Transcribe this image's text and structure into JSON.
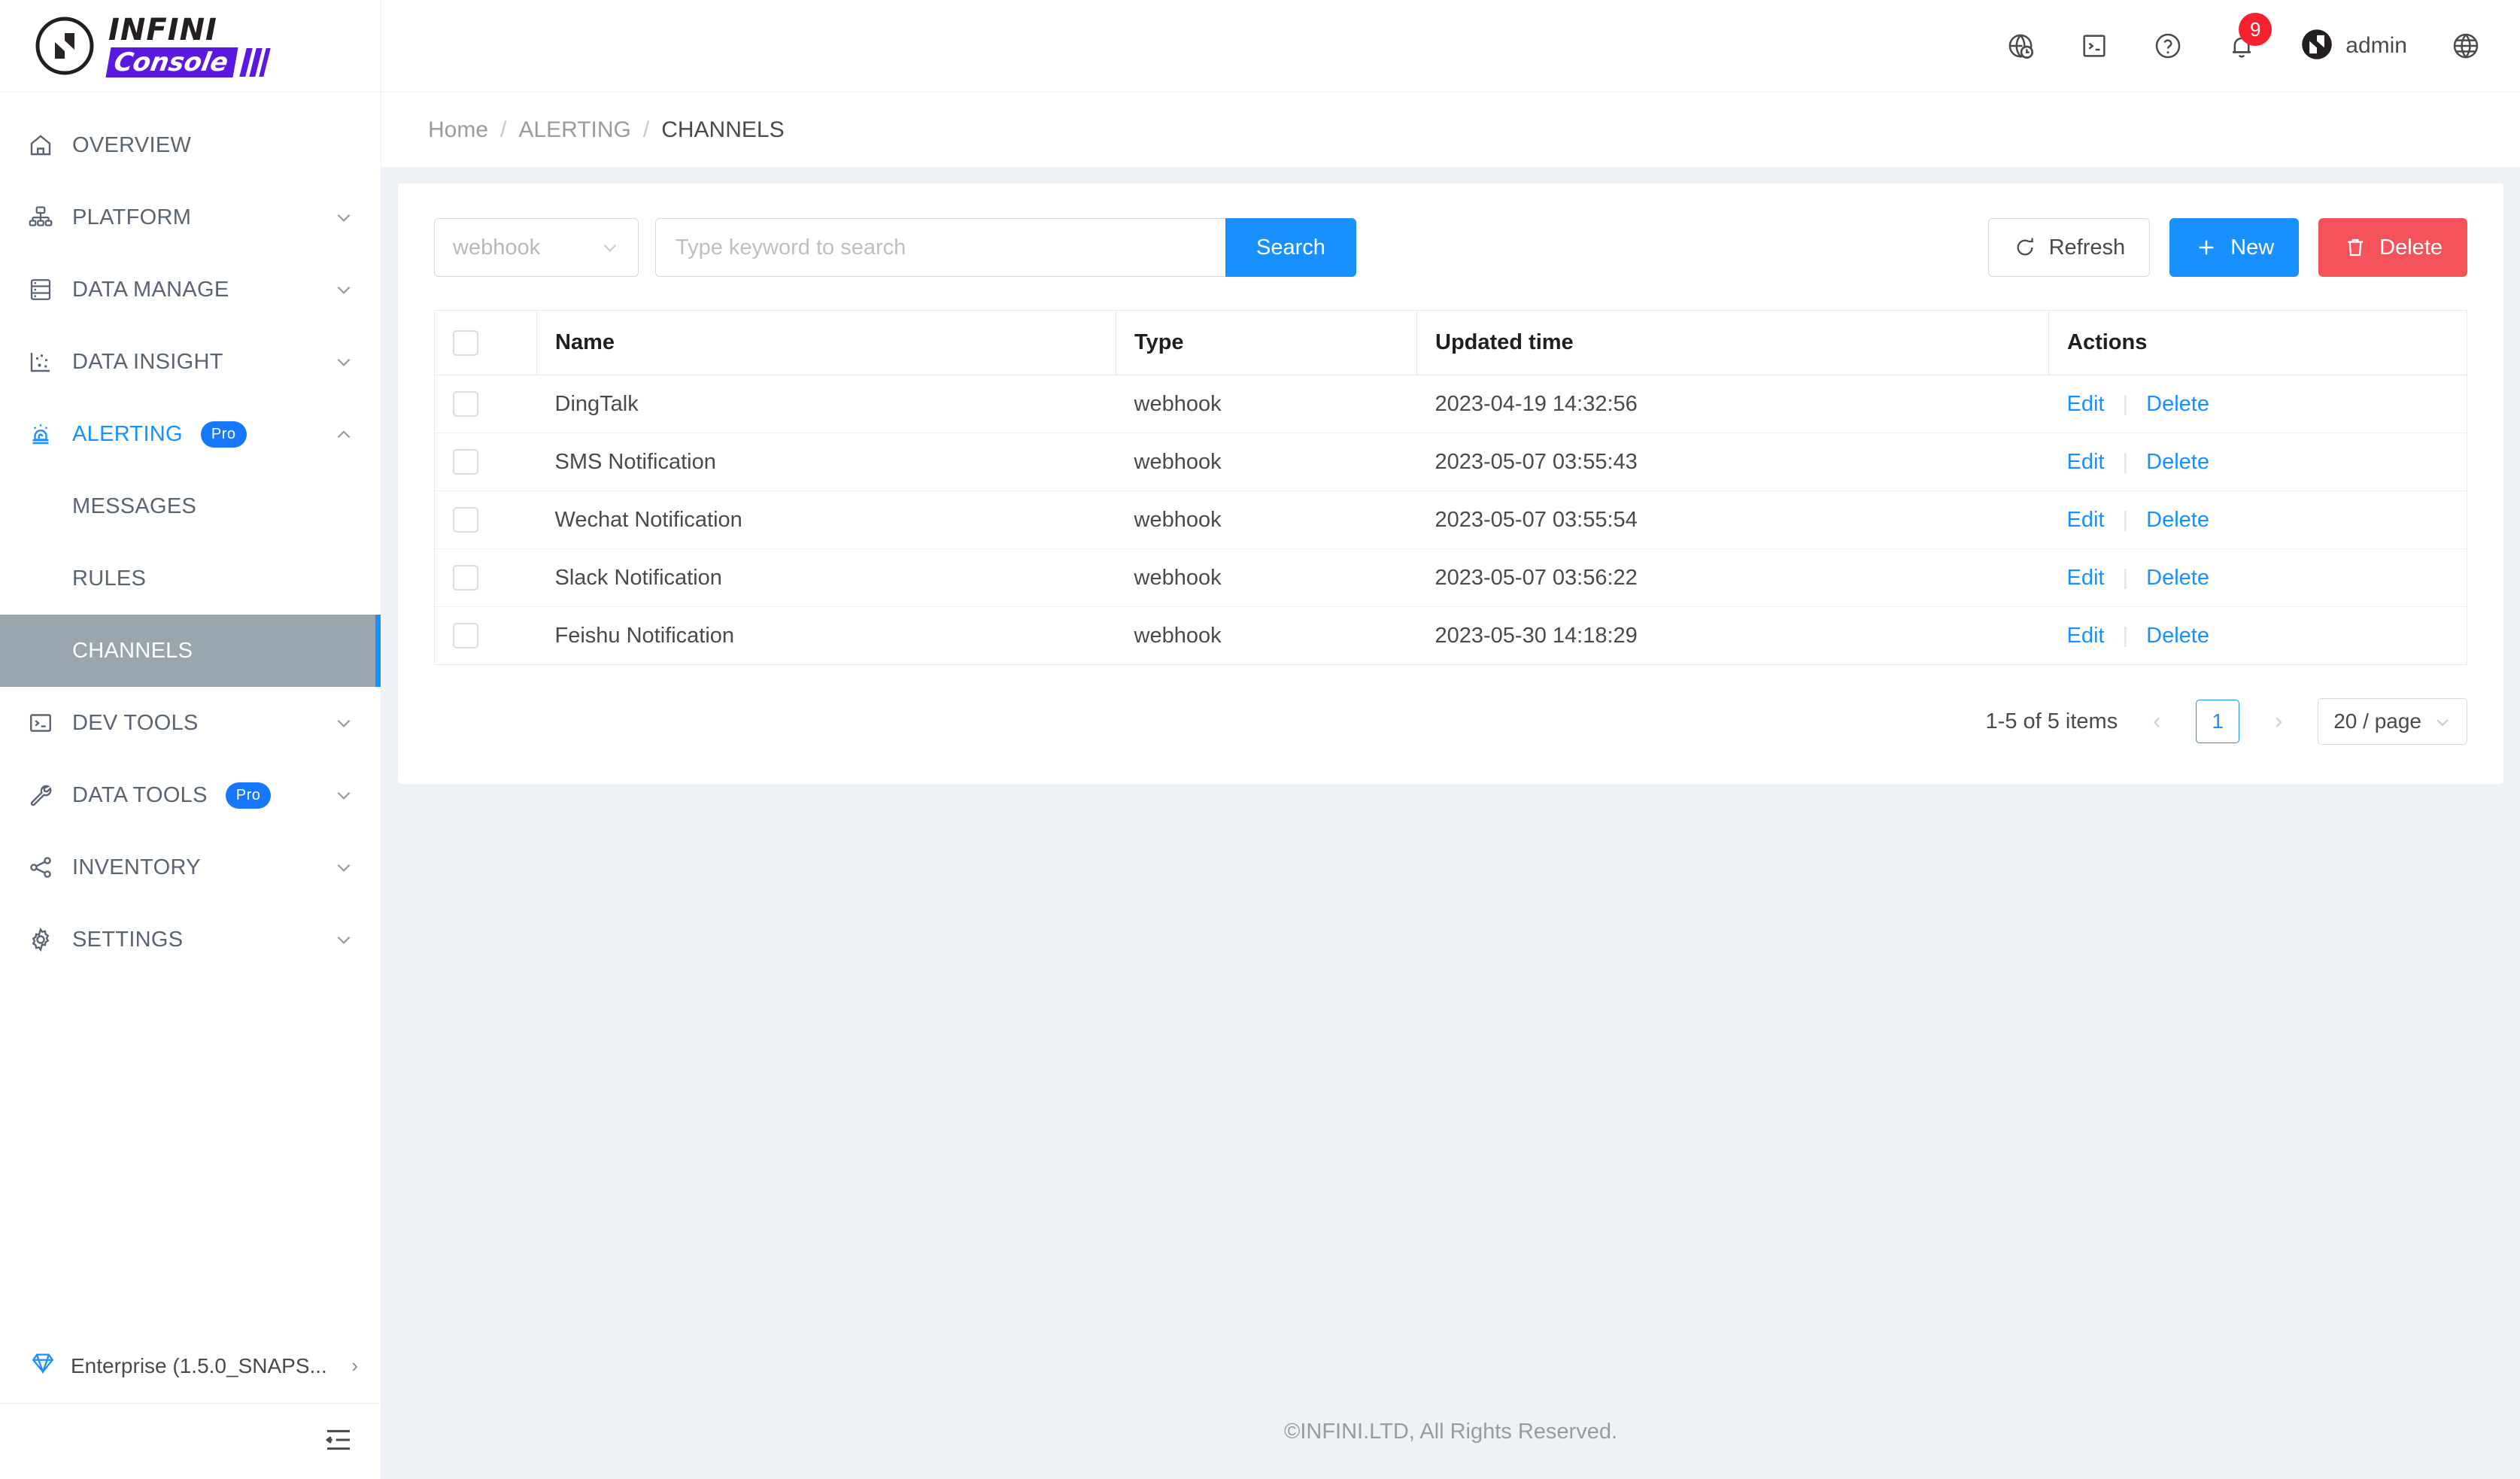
{
  "brand": {
    "logo_primary": "INFINI",
    "logo_secondary": "Console",
    "logo_mark_icon": "infini-n-logo-icon"
  },
  "sidebar": {
    "items": [
      {
        "label": "OVERVIEW",
        "icon": "home-icon",
        "expandable": false,
        "badge": null,
        "active": false
      },
      {
        "label": "PLATFORM",
        "icon": "platform-nodes-icon",
        "expandable": true,
        "badge": null,
        "active": false
      },
      {
        "label": "DATA MANAGE",
        "icon": "database-icon",
        "expandable": true,
        "badge": null,
        "active": false
      },
      {
        "label": "DATA INSIGHT",
        "icon": "chart-scatter-icon",
        "expandable": true,
        "badge": null,
        "active": false
      },
      {
        "label": "ALERTING",
        "icon": "alarm-light-icon",
        "expandable": true,
        "badge": "Pro",
        "active": true
      },
      {
        "label": "DEV TOOLS",
        "icon": "terminal-icon",
        "expandable": true,
        "badge": null,
        "active": false
      },
      {
        "label": "DATA TOOLS",
        "icon": "wrench-icon",
        "expandable": true,
        "badge": "Pro",
        "active": false
      },
      {
        "label": "INVENTORY",
        "icon": "share-nodes-icon",
        "expandable": true,
        "badge": null,
        "active": false
      },
      {
        "label": "SETTINGS",
        "icon": "gear-icon",
        "expandable": true,
        "badge": null,
        "active": false
      }
    ],
    "alerting_subitems": [
      {
        "label": "MESSAGES",
        "selected": false
      },
      {
        "label": "RULES",
        "selected": false
      },
      {
        "label": "CHANNELS",
        "selected": true
      }
    ],
    "footer": {
      "license_label": "Enterprise (1.5.0_SNAPS...",
      "license_icon": "diamond-icon",
      "license_chevron": "›",
      "collapse_icon": "collapse-sidebar-icon"
    }
  },
  "topbar": {
    "icons": [
      {
        "name": "globe-clock-icon"
      },
      {
        "name": "console-terminal-icon"
      },
      {
        "name": "help-circle-icon"
      }
    ],
    "notifications": {
      "icon": "bell-icon",
      "count": "9"
    },
    "user": {
      "avatar_icon": "infini-avatar-icon",
      "name": "admin"
    },
    "language_icon": "globe-language-icon"
  },
  "breadcrumb": {
    "items": [
      "Home",
      "ALERTING",
      "CHANNELS"
    ],
    "separator": "/"
  },
  "toolbar": {
    "type_filter": {
      "value": "webhook",
      "caret_icon": "chevron-down-icon"
    },
    "search": {
      "placeholder": "Type keyword to search",
      "value": ""
    },
    "search_label": "Search",
    "refresh_label": "Refresh",
    "refresh_icon": "refresh-icon",
    "new_label": "New",
    "new_icon": "plus-icon",
    "delete_label": "Delete",
    "delete_icon": "trash-icon"
  },
  "table": {
    "columns": [
      "",
      "Name",
      "Type",
      "Updated time",
      "Actions"
    ],
    "rows": [
      {
        "name": "DingTalk",
        "type": "webhook",
        "updated": "2023-04-19 14:32:56",
        "edit": "Edit",
        "delete": "Delete"
      },
      {
        "name": "SMS Notification",
        "type": "webhook",
        "updated": "2023-05-07 03:55:43",
        "edit": "Edit",
        "delete": "Delete"
      },
      {
        "name": "Wechat Notification",
        "type": "webhook",
        "updated": "2023-05-07 03:55:54",
        "edit": "Edit",
        "delete": "Delete"
      },
      {
        "name": "Slack Notification",
        "type": "webhook",
        "updated": "2023-05-07 03:56:22",
        "edit": "Edit",
        "delete": "Delete"
      },
      {
        "name": "Feishu Notification",
        "type": "webhook",
        "updated": "2023-05-30 14:18:29",
        "edit": "Edit",
        "delete": "Delete"
      }
    ],
    "action_separator": "|"
  },
  "pagination": {
    "summary": "1-5 of 5 items",
    "prev_icon": "‹",
    "next_icon": "›",
    "current_page": "1",
    "page_size": "20 / page",
    "page_size_caret": "chevron-down-icon"
  },
  "footer": {
    "copyright": "©INFINI.LTD, All Rights Reserved."
  },
  "colors": {
    "accent": "#1890ff",
    "brand_purple": "#5b18e0",
    "danger": "#f4535b",
    "badge_red": "#f5222d",
    "selected_gray": "#9aa5ae",
    "page_bg": "#eef1f5"
  }
}
